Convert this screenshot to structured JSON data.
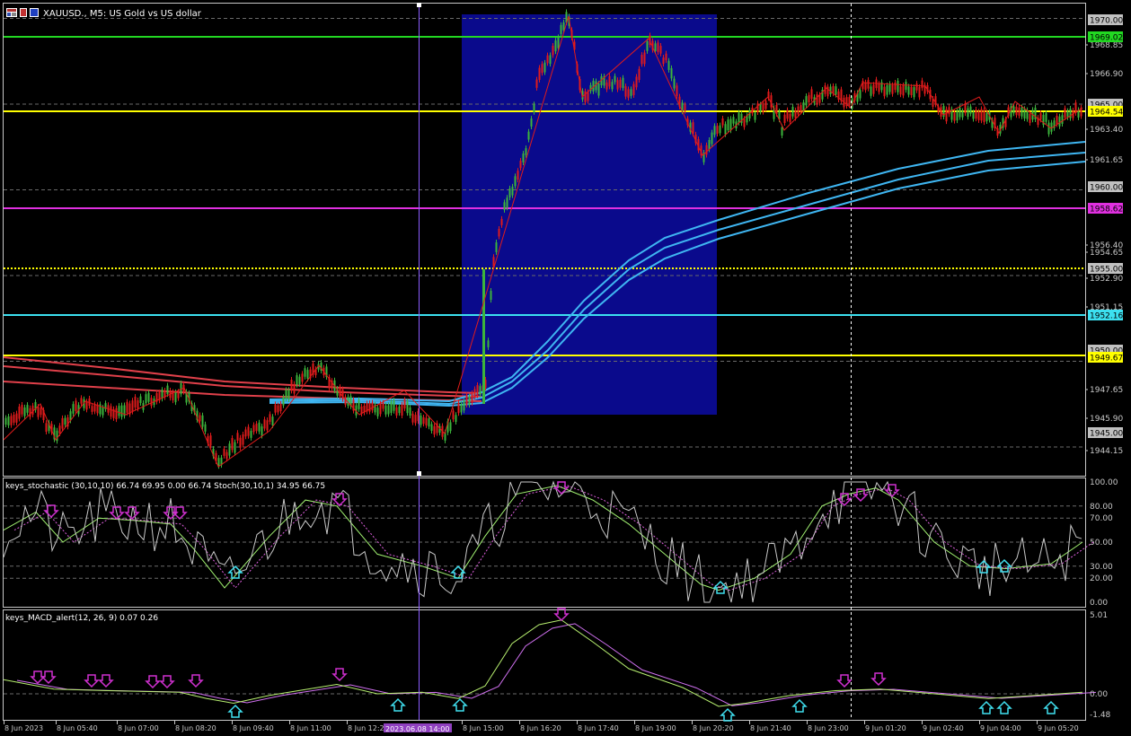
{
  "header": {
    "symbol_title": "XAUUSD., M5:  US Gold vs US dollar"
  },
  "colors": {
    "background": "#000000",
    "axis": "#c8c8c8",
    "grid": "#6a6a6a",
    "bull": "#3cb43c",
    "bear": "#e01b1b",
    "highlight": "#0a0a8c",
    "ma_red": "#e0404a",
    "ma_blue": "#3fb6f2",
    "green_line": "#22d822",
    "yellow_line": "#ffff00",
    "magenta_line": "#e030e0",
    "cyan_line": "#3ce0f0",
    "vline": "#8a5cff",
    "stoch_main": "#c8c8c8",
    "stoch_signal": "#e060e0",
    "stoch_green": "#a0f070",
    "macd_main": "#d070f0",
    "macd_signal": "#b8f070",
    "arrow_down": "#d030d0",
    "arrow_up": "#40e0f0"
  },
  "icons": {
    "chart_menu_icon": "chart-menu-icon"
  },
  "price_axis": {
    "ticks": [
      "1968.85",
      "1966.90",
      "1963.40",
      "1961.65",
      "1956.40",
      "1954.65",
      "1952.90",
      "1951.15",
      "1947.65",
      "1945.90",
      "1944.15"
    ],
    "level_labels": [
      {
        "text": "1970.00",
        "kind": "grey"
      },
      {
        "text": "1969.02",
        "kind": "green"
      },
      {
        "text": "1965.00",
        "kind": "grey"
      },
      {
        "text": "1964.54",
        "kind": "yellow"
      },
      {
        "text": "1960.00",
        "kind": "grey"
      },
      {
        "text": "1958.62",
        "kind": "magenta"
      },
      {
        "text": "1955.00",
        "kind": "grey"
      },
      {
        "text": "1952.16",
        "kind": "cyan"
      },
      {
        "text": "1950.00",
        "kind": "grey"
      },
      {
        "text": "1949.67",
        "kind": "yellow"
      },
      {
        "text": "1945.00",
        "kind": "grey"
      }
    ]
  },
  "stochastic": {
    "label": "keys_stochastic (30,10,10) 66.74 69.95 0.00 66.74 Stoch(30,10,1) 34.95 66.75",
    "ticks": [
      "100.00",
      "80.00",
      "70.00",
      "50.00",
      "30.00",
      "20.00",
      "0.00"
    ]
  },
  "macd": {
    "label": "keys_MACD_alert(12, 26, 9) 0.07 0.26",
    "ticks": [
      "5.01",
      "0.00",
      "-1.48"
    ]
  },
  "time_axis": {
    "labels": [
      "8 Jun 2023",
      "8 Jun 05:40",
      "8 Jun 07:00",
      "8 Jun 08:20",
      "8 Jun 09:40",
      "8 Jun 11:00",
      "8 Jun 12:2",
      "8 Jun 15:00",
      "8 Jun 16:20",
      "8 Jun 17:40",
      "8 Jun 19:00",
      "8 Jun 20:20",
      "8 Jun 21:40",
      "8 Jun 23:00",
      "9 Jun 01:20",
      "9 Jun 02:40",
      "9 Jun 04:00",
      "9 Jun 05:20"
    ],
    "cursor_label": "2023.06.08 14:00"
  }
}
